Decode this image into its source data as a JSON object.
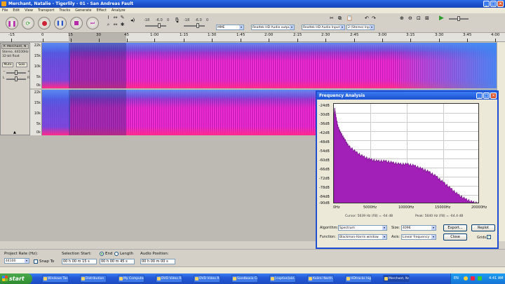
{
  "window": {
    "title": "Merchant, Natalie - Tigerlily - 01 - San Andreas Fault"
  },
  "menu": [
    "File",
    "Edit",
    "View",
    "Transport",
    "Tracks",
    "Generate",
    "Effect",
    "Analyze"
  ],
  "meters": {
    "db_left": [
      "-18",
      "-6.0",
      "0"
    ],
    "db_right": [
      "-18",
      "-6.0",
      "0"
    ]
  },
  "devices": {
    "host": "MME",
    "output": "Realtek HD Audio output",
    "input": "Realtek HD Audio Input",
    "channels": "2 (Stereo) Inp"
  },
  "ruler": {
    "ticks": [
      "-15",
      "0",
      "15",
      "30",
      "45",
      "1:00",
      "1:15",
      "1:30",
      "1:45",
      "2:00",
      "2:15",
      "2:30",
      "2:45",
      "3:00",
      "3:15",
      "3:30",
      "3:45",
      "4:00"
    ]
  },
  "track": {
    "name": "Merchant, N",
    "format": "Stereo, 44100Hz",
    "bitdepth": "32-bit float",
    "mute": "Mute",
    "solo": "Solo",
    "pan_left": "L",
    "pan_right": "R",
    "y_labels": [
      "22k",
      "15k",
      "10k",
      "5k",
      "0k"
    ]
  },
  "freq_dialog": {
    "title": "Frequency Analysis",
    "db_labels": [
      "-24dB",
      "-30dB",
      "-36dB",
      "-42dB",
      "-48dB",
      "-54dB",
      "-60dB",
      "-66dB",
      "-72dB",
      "-78dB",
      "-84dB",
      "-90dB"
    ],
    "hz_labels": [
      "0Hz",
      "5000Hz",
      "10000Hz",
      "15000Hz",
      "20000Hz"
    ],
    "cursor_text": "Cursor: 5639 Hz (F8) = -64 dB",
    "peak_text": "Peak: 5640 Hz (F8) = -64.4 dB",
    "algorithm_label": "Algorithm:",
    "algorithm": "Spectrum",
    "size_label": "Size:",
    "size": "4096",
    "function_label": "Function:",
    "function": "Blackman-Harris window",
    "axis_label": "Axis:",
    "axis": "Linear frequency",
    "export_label": "Export...",
    "replot_label": "Replot",
    "close_label": "Close",
    "grids_label": "Grids"
  },
  "selection_bar": {
    "project_rate_label": "Project Rate (Hz):",
    "project_rate": "44100",
    "snap_label": "Snap To",
    "selection_start_label": "Selection Start:",
    "start_value": "00 h 00 m 15 s",
    "end_label": "End",
    "length_label": "Length",
    "end_value": "00 h 00 m 45 s",
    "audio_position_label": "Audio Position:",
    "audio_position": "00 h 00 m 00 s"
  },
  "taskbar": {
    "start": "start",
    "items": [
      "Windows Tas...",
      "Distribution",
      "My Computer",
      "DVD Video Ripe",
      "DVD Video Ripe",
      "Sandboxie Co...",
      "[coptive]ald...",
      "Kalimi North...",
      "HDtracks high...",
      "Merchant, Na..."
    ],
    "lang": "EN",
    "clock": "4:41 AM"
  },
  "chart_data": {
    "type": "area",
    "title": "",
    "xlabel": "",
    "ylabel": "",
    "xlim": [
      0,
      20000
    ],
    "ylim": [
      -90,
      -24
    ],
    "grid": true,
    "x": [
      0,
      100,
      300,
      600,
      1000,
      1500,
      2000,
      3000,
      4000,
      5000,
      6000,
      7000,
      8000,
      9000,
      10000,
      11000,
      12000,
      13000,
      14000,
      15000,
      16000,
      17000,
      18000,
      19000,
      20000
    ],
    "y": [
      -34,
      -27,
      -33,
      -40,
      -44,
      -48,
      -52,
      -56,
      -59,
      -61,
      -62,
      -62,
      -63,
      -64,
      -64,
      -65,
      -67,
      -69,
      -72,
      -76,
      -80,
      -84,
      -87,
      -89,
      -90
    ]
  }
}
